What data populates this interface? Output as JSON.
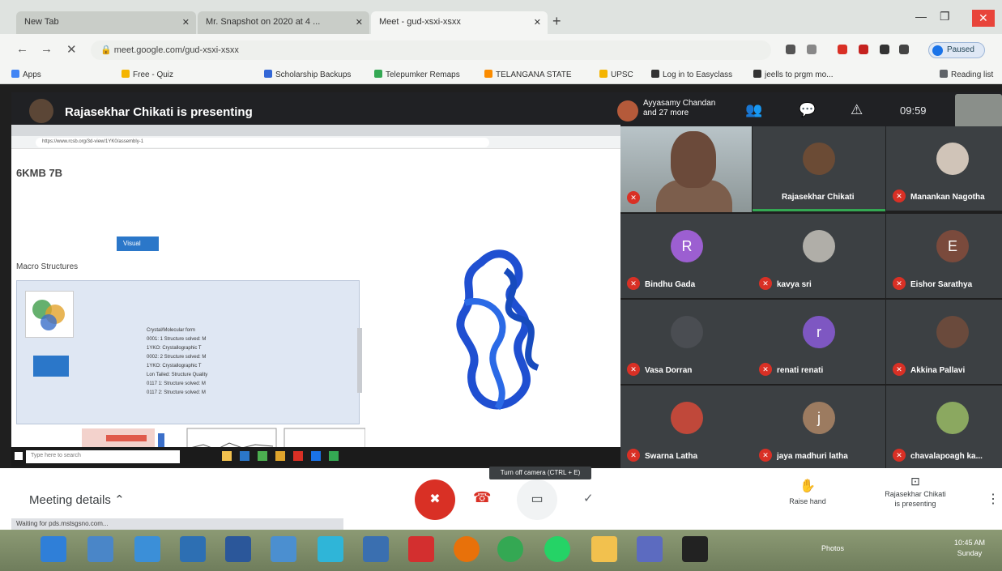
{
  "browser": {
    "tabs": [
      {
        "label": "New Tab",
        "active": false
      },
      {
        "label": "Mr. Snapshot on 2020 at 4 ...",
        "active": false
      },
      {
        "label": "Meet - gud-xsxi-xsxx",
        "active": true
      }
    ],
    "new_tab": "+",
    "back": "←",
    "forward": "→",
    "reload": "✕",
    "url": "meet.google.com/gud-xsxi-xsxx",
    "profile_label": "Paused",
    "window_controls": {
      "minimize": "—",
      "maximize": "❐",
      "close": "✕"
    }
  },
  "bookmarks": [
    {
      "label": "Apps",
      "color": "#4285f4"
    },
    {
      "label": "Free - Quiz",
      "color": "#f4b400"
    },
    {
      "label": "Scholarship Backups",
      "color": "#3367d6"
    },
    {
      "label": "Telepumker Remaps",
      "color": "#34a853"
    },
    {
      "label": "TELANGANA STATE",
      "color": "#fb8c00"
    },
    {
      "label": "UPSC",
      "color": "#f4b400"
    },
    {
      "label": "Log in to Easyclass",
      "color": "#333333"
    },
    {
      "label": "jeells to prgm mo...",
      "color": "#333333"
    },
    {
      "label": "Reading list",
      "color": "#5f6368"
    }
  ],
  "meet": {
    "presenter_text": "Rajasekhar Chikati is presenting",
    "participants_chip": {
      "line1": "Ayyasamy Chandan",
      "line2": "and 27 more"
    },
    "icons": {
      "people": "👥",
      "chat": "💬",
      "activities": "⚠"
    },
    "clock": "09:59",
    "tiles": [
      {
        "name": "Rajasekhar Chikati",
        "initial": "",
        "color": "#6b4b35"
      },
      {
        "name": "Manankan Nagotha",
        "initial": "",
        "color": "#d0c4b8"
      },
      {
        "name": "Bindhu Gada",
        "initial": "R",
        "color": "#9c5fd1"
      },
      {
        "name": "kavya sri",
        "initial": "",
        "color": "#b0aea8"
      },
      {
        "name": "Eishor Sarathya",
        "initial": "E",
        "color": "#7a4a3c"
      },
      {
        "name": "Vasa Dorran",
        "initial": "",
        "color": "#4a4d52"
      },
      {
        "name": "renati renati",
        "initial": "r",
        "color": "#7e57c2"
      },
      {
        "name": "Akkina Pallavi",
        "initial": "",
        "color": "#6a4a3c"
      },
      {
        "name": "Swarna Latha",
        "initial": "",
        "color": "#c0483a"
      },
      {
        "name": "jaya madhuri latha",
        "initial": "j",
        "color": "#9c7b60"
      },
      {
        "name": "chavalapoagh ka...",
        "initial": "",
        "color": "#8ba860"
      }
    ],
    "tooltip": "Turn off camera (CTRL + E)",
    "bottom": {
      "meeting_details": "Meeting details",
      "chevron": "⌃",
      "status": "Waiting for pds.mstsgsno.com...",
      "mic": "✖",
      "hangup": "☎",
      "camera": "▭",
      "check": "✓",
      "raise_hand": "Raise hand",
      "present_line1": "Rajasekhar Chikati",
      "present_line2": "is presenting",
      "more": "⋮"
    }
  },
  "shared_screen": {
    "url": "https://www.rcsb.org/3d-view/1YK0/assembly-1",
    "heading": "6KMB 7B",
    "view_button": "Visual",
    "section": "Macro Structures",
    "lines": [
      "Crystal/Molecular form",
      "0001: 1 Structure solved: M",
      "1YKO: Crystallographic T",
      "0002: 2 Structure solved: M",
      "1YKO: Crystallographic T",
      "Lon Tailed: Structure  Quality",
      "0117 1: Structure solved: M",
      "0117 2: Structure solved: M"
    ],
    "search_placeholder": "Type here to search"
  },
  "windows": {
    "taskbar_apps": [
      {
        "icon": "ie-icon",
        "color": "#2f7fd8"
      },
      {
        "icon": "monitor-icon",
        "color": "#4a86c8"
      },
      {
        "icon": "photos-icon",
        "color": "#3b8fd8"
      },
      {
        "icon": "explorer-icon",
        "color": "#2d6fb3"
      },
      {
        "icon": "word-icon",
        "color": "#2b579a"
      },
      {
        "icon": "files-icon",
        "color": "#4b8fd0"
      },
      {
        "icon": "gem-icon",
        "color": "#2fb5d8"
      },
      {
        "icon": "calc-icon",
        "color": "#3a6fb0"
      },
      {
        "icon": "m-icon",
        "color": "#d32f2f"
      },
      {
        "icon": "firefox-icon",
        "color": "#e8710a"
      },
      {
        "icon": "chrome-icon",
        "color": "#34a853"
      },
      {
        "icon": "whatsapp-icon",
        "color": "#25d366"
      },
      {
        "icon": "folder-icon",
        "color": "#f2c14e"
      },
      {
        "icon": "app-icon",
        "color": "#5c6bc0"
      },
      {
        "icon": "puzzle-icon",
        "color": "#222222"
      }
    ],
    "tray_text": "Photos",
    "clock_line1": "10:45 AM",
    "clock_line2": "Sunday"
  }
}
